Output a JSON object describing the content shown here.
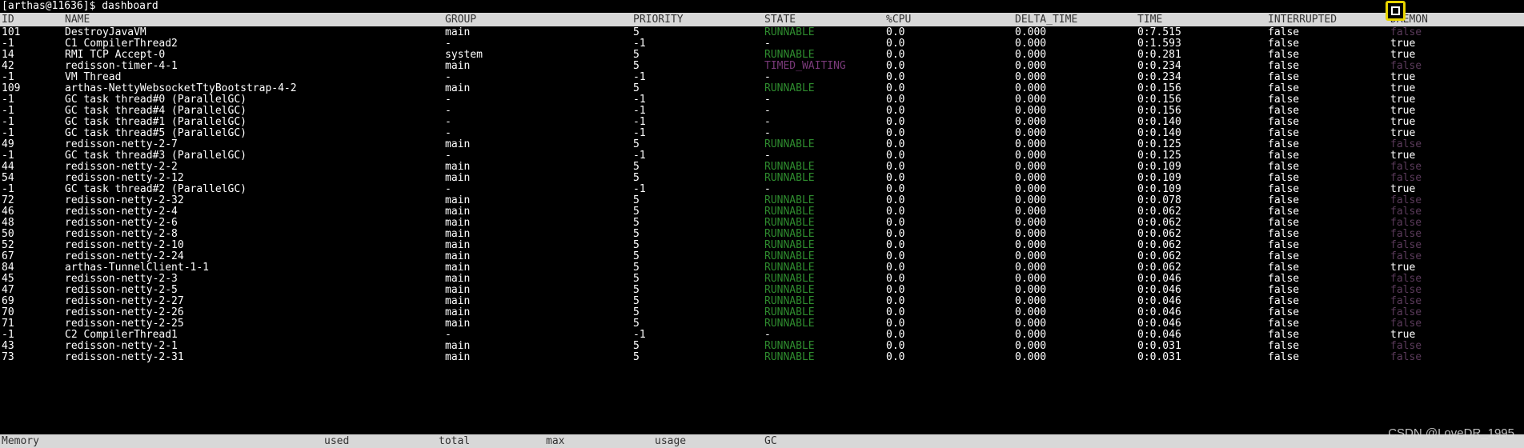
{
  "prompt": "[arthas@11636]$ dashboard",
  "header": {
    "id": "ID",
    "name": "NAME",
    "group": "GROUP",
    "priority": "PRIORITY",
    "state": "STATE",
    "cpu": "%CPU",
    "delta_time": "DELTA_TIME",
    "time": "TIME",
    "interrupted": "INTERRUPTED",
    "daemon": "DAEMON"
  },
  "rows": [
    [
      "101",
      "DestroyJavaVM",
      "main",
      "5",
      "RUNNABLE",
      "0.0",
      "0.000",
      "0:7.515",
      "false",
      "false"
    ],
    [
      "-1",
      "C1 CompilerThread2",
      "-",
      "-1",
      "-",
      "0.0",
      "0.000",
      "0:1.593",
      "false",
      "true"
    ],
    [
      "14",
      "RMI TCP Accept-0",
      "system",
      "5",
      "RUNNABLE",
      "0.0",
      "0.000",
      "0:0.281",
      "false",
      "true"
    ],
    [
      "42",
      "redisson-timer-4-1",
      "main",
      "5",
      "TIMED_WAITING",
      "0.0",
      "0.000",
      "0:0.234",
      "false",
      "false"
    ],
    [
      "-1",
      "VM Thread",
      "-",
      "-1",
      "-",
      "0.0",
      "0.000",
      "0:0.234",
      "false",
      "true"
    ],
    [
      "109",
      "arthas-NettyWebsocketTtyBootstrap-4-2",
      "main",
      "5",
      "RUNNABLE",
      "0.0",
      "0.000",
      "0:0.156",
      "false",
      "true"
    ],
    [
      "-1",
      "GC task thread#0 (ParallelGC)",
      "-",
      "-1",
      "-",
      "0.0",
      "0.000",
      "0:0.156",
      "false",
      "true"
    ],
    [
      "-1",
      "GC task thread#4 (ParallelGC)",
      "-",
      "-1",
      "-",
      "0.0",
      "0.000",
      "0:0.156",
      "false",
      "true"
    ],
    [
      "-1",
      "GC task thread#1 (ParallelGC)",
      "-",
      "-1",
      "-",
      "0.0",
      "0.000",
      "0:0.140",
      "false",
      "true"
    ],
    [
      "-1",
      "GC task thread#5 (ParallelGC)",
      "-",
      "-1",
      "-",
      "0.0",
      "0.000",
      "0:0.140",
      "false",
      "true"
    ],
    [
      "49",
      "redisson-netty-2-7",
      "main",
      "5",
      "RUNNABLE",
      "0.0",
      "0.000",
      "0:0.125",
      "false",
      "false"
    ],
    [
      "-1",
      "GC task thread#3 (ParallelGC)",
      "-",
      "-1",
      "-",
      "0.0",
      "0.000",
      "0:0.125",
      "false",
      "true"
    ],
    [
      "44",
      "redisson-netty-2-2",
      "main",
      "5",
      "RUNNABLE",
      "0.0",
      "0.000",
      "0:0.109",
      "false",
      "false"
    ],
    [
      "54",
      "redisson-netty-2-12",
      "main",
      "5",
      "RUNNABLE",
      "0.0",
      "0.000",
      "0:0.109",
      "false",
      "false"
    ],
    [
      "-1",
      "GC task thread#2 (ParallelGC)",
      "-",
      "-1",
      "-",
      "0.0",
      "0.000",
      "0:0.109",
      "false",
      "true"
    ],
    [
      "72",
      "redisson-netty-2-32",
      "main",
      "5",
      "RUNNABLE",
      "0.0",
      "0.000",
      "0:0.078",
      "false",
      "false"
    ],
    [
      "46",
      "redisson-netty-2-4",
      "main",
      "5",
      "RUNNABLE",
      "0.0",
      "0.000",
      "0:0.062",
      "false",
      "false"
    ],
    [
      "48",
      "redisson-netty-2-6",
      "main",
      "5",
      "RUNNABLE",
      "0.0",
      "0.000",
      "0:0.062",
      "false",
      "false"
    ],
    [
      "50",
      "redisson-netty-2-8",
      "main",
      "5",
      "RUNNABLE",
      "0.0",
      "0.000",
      "0:0.062",
      "false",
      "false"
    ],
    [
      "52",
      "redisson-netty-2-10",
      "main",
      "5",
      "RUNNABLE",
      "0.0",
      "0.000",
      "0:0.062",
      "false",
      "false"
    ],
    [
      "67",
      "redisson-netty-2-24",
      "main",
      "5",
      "RUNNABLE",
      "0.0",
      "0.000",
      "0:0.062",
      "false",
      "false"
    ],
    [
      "84",
      "arthas-TunnelClient-1-1",
      "main",
      "5",
      "RUNNABLE",
      "0.0",
      "0.000",
      "0:0.062",
      "false",
      "true"
    ],
    [
      "45",
      "redisson-netty-2-3",
      "main",
      "5",
      "RUNNABLE",
      "0.0",
      "0.000",
      "0:0.046",
      "false",
      "false"
    ],
    [
      "47",
      "redisson-netty-2-5",
      "main",
      "5",
      "RUNNABLE",
      "0.0",
      "0.000",
      "0:0.046",
      "false",
      "false"
    ],
    [
      "69",
      "redisson-netty-2-27",
      "main",
      "5",
      "RUNNABLE",
      "0.0",
      "0.000",
      "0:0.046",
      "false",
      "false"
    ],
    [
      "70",
      "redisson-netty-2-26",
      "main",
      "5",
      "RUNNABLE",
      "0.0",
      "0.000",
      "0:0.046",
      "false",
      "false"
    ],
    [
      "71",
      "redisson-netty-2-25",
      "main",
      "5",
      "RUNNABLE",
      "0.0",
      "0.000",
      "0:0.046",
      "false",
      "false"
    ],
    [
      "-1",
      "C2 CompilerThread1",
      "-",
      "-1",
      "-",
      "0.0",
      "0.000",
      "0:0.046",
      "false",
      "true"
    ],
    [
      "43",
      "redisson-netty-2-1",
      "main",
      "5",
      "RUNNABLE",
      "0.0",
      "0.000",
      "0:0.031",
      "false",
      "false"
    ],
    [
      "73",
      "redisson-netty-2-31",
      "main",
      "5",
      "RUNNABLE",
      "0.0",
      "0.000",
      "0:0.031",
      "false",
      "false"
    ]
  ],
  "footer": {
    "memory": "Memory",
    "used": "used",
    "total": "total",
    "max": "max",
    "usage": "usage",
    "gc": "GC"
  },
  "watermark": "CSDN @LoveDR_1995",
  "colors": {
    "runnable": "#2e8b2e",
    "timed_waiting": "#7a3a7a",
    "daemon_false": "#5a3a5a",
    "header_bg": "#d8d8d8",
    "focus_box": "#e8d400"
  },
  "icons": {
    "focus": "fullscreen-focus-icon"
  }
}
